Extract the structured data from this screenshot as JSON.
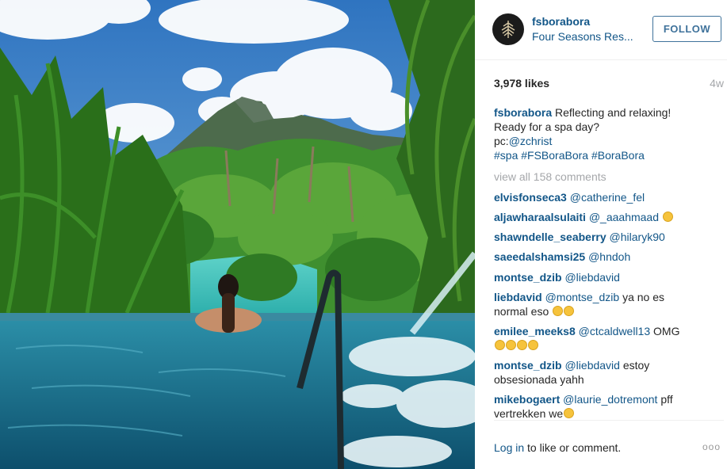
{
  "post": {
    "username": "fsborabora",
    "fullname": "Four Seasons Res...",
    "follow_label": "FOLLOW",
    "likes": "3,978 likes",
    "time_ago": "4w",
    "caption_user": "fsborabora",
    "caption_text_1": "Reflecting and relaxing!",
    "caption_text_2": "Ready for a spa day?",
    "caption_pc": "pc:",
    "caption_pc_user": "@zchrist",
    "hashtags": "#spa #FSBoraBora #BoraBora",
    "view_all": "view all 158 comments"
  },
  "comments": [
    {
      "user": "elvisfonseca3",
      "text_link": "@catherine_fel",
      "text": ""
    },
    {
      "user": "aljawharaalsulaiti",
      "text_link": "@_aaahmaad",
      "text": ""
    },
    {
      "user": "shawndelle_seaberry",
      "text_link": "@hilaryk90",
      "text": ""
    },
    {
      "user": "saeedalshamsi25",
      "text_link": "@hndoh",
      "text": ""
    },
    {
      "user": "montse_dzib",
      "text_link": "@liebdavid",
      "text": ""
    },
    {
      "user": "liebdavid",
      "text_link": "@montse_dzib",
      "text": "ya no es",
      "text2": "normal eso"
    },
    {
      "user": "emilee_meeks8",
      "text_link": "@ctcaldwell13",
      "text": "OMG"
    },
    {
      "user": "montse_dzib",
      "text_link": "@liebdavid",
      "text": "estoy",
      "text2": "obsesionada yahh"
    },
    {
      "user": "mikebogaert",
      "text_link": "@laurie_dotremont",
      "text": "pff",
      "text2": "vertrekken we"
    }
  ],
  "footer": {
    "login_link": "Log in",
    "login_text": " to like or comment.",
    "more": "ooo"
  },
  "icons": {
    "avatar": "four-seasons-tree-logo",
    "emoji": "smiley-emoji"
  }
}
